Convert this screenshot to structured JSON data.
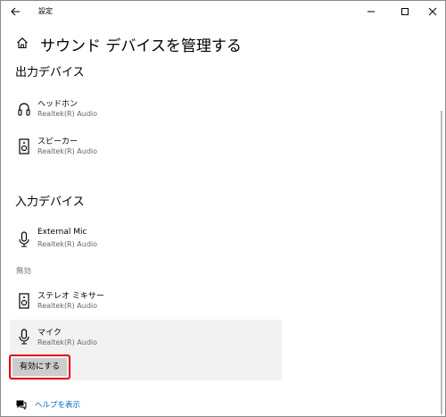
{
  "window": {
    "app_title": "設定",
    "controls": {
      "minimize": "minimize-icon",
      "maximize": "maximize-icon",
      "close": "close-icon"
    }
  },
  "page": {
    "title": "サウンド デバイスを管理する"
  },
  "output": {
    "section_title": "出力デバイス",
    "devices": [
      {
        "name": "ヘッドホン",
        "driver": "Realtek(R) Audio",
        "icon": "headphones-icon"
      },
      {
        "name": "スピーカー",
        "driver": "Realtek(R) Audio",
        "icon": "speaker-icon"
      }
    ]
  },
  "input": {
    "section_title": "入力デバイス",
    "devices": [
      {
        "name": "External Mic",
        "driver": "Realtek(R) Audio",
        "icon": "microphone-icon"
      }
    ],
    "disabled_label": "無効",
    "disabled_devices": [
      {
        "name": "ステレオ ミキサー",
        "driver": "Realtek(R) Audio",
        "icon": "speaker-icon"
      },
      {
        "name": "マイク",
        "driver": "Realtek(R) Audio",
        "icon": "microphone-icon"
      }
    ],
    "enable_button": "有効にする"
  },
  "help": {
    "label": "ヘルプを表示"
  },
  "colors": {
    "link": "#0067c0",
    "highlight_border": "#e60012",
    "selected_bg": "#f2f2f2",
    "button_bg": "#cccccc"
  }
}
